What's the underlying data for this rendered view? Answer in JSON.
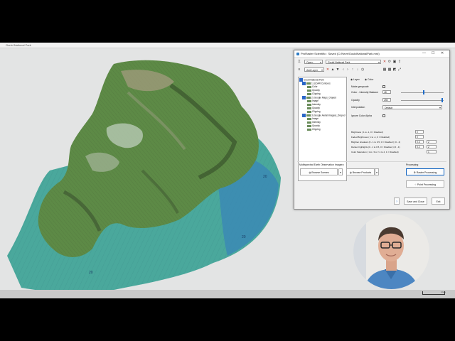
{
  "app": {
    "window_title": "Gould National Park"
  },
  "dialog": {
    "title": "ProRaster Scientific : Saved (C:/Neve/GouldNationalPark.mrd)",
    "open_label": "Open...",
    "project_name": "Gould National Park",
    "add_layer_label": "Add Layer",
    "tabs": {
      "layer": "Layer",
      "color": "Color"
    },
    "tree": [
      {
        "label": "Gould National Park",
        "level": 0,
        "checked": true
      },
      {
        "label": "1) LiDAR Contours",
        "level": 1,
        "checked": true
      },
      {
        "label": "Color",
        "level": 2
      },
      {
        "label": "Opacity",
        "level": 2
      },
      {
        "label": "Clipping",
        "level": 2
      },
      {
        "label": "2) Google Maps_Draped",
        "level": 1,
        "checked": true
      },
      {
        "label": "Image",
        "level": 2
      },
      {
        "label": "Intensity",
        "level": 2
      },
      {
        "label": "Opacity",
        "level": 2
      },
      {
        "label": "Clipping",
        "level": 2
      },
      {
        "label": "3) Google Aerial Imagery_Draped",
        "level": 1,
        "checked": true
      },
      {
        "label": "Image",
        "level": 2
      },
      {
        "label": "Intensity",
        "level": 2
      },
      {
        "label": "Opacity",
        "level": 2
      },
      {
        "label": "Clipping",
        "level": 2
      }
    ],
    "color": {
      "make_greyscale": "Make greyscale",
      "intensity_label": "Color - Intensity Balance",
      "intensity_value": "48",
      "opacity_label": "Opacity",
      "opacity_value": "255",
      "interpolation_label": "Interpolation",
      "interpolation_value": "Default",
      "ignore_alpha": "Ignore Color Alpha",
      "brightness_label": "Brightness ( 1 to -1, 0 = Disabled)",
      "brightness_value": "0",
      "faded_label": "Faded Brightness ( 1 to -1, 0 = Disabled)",
      "faded_value": "0",
      "shadows_label": "Brighten shadows (0 - 1 to 0.5, 0 = Disabled ) (0 - 4)",
      "shadows_value_1": "0.3",
      "shadows_value_2": "2",
      "highlights_label": "Darken highlights (0 - 1 to 0.5, 0 = Disabled ) (0 - 4)",
      "highlights_value_1": "0.2",
      "highlights_value_2": "2",
      "saturation_label": "Color Saturation ( 1 to <0 or >1 to 4, 1 = Disabled)",
      "saturation_value": "1"
    },
    "multispectral": {
      "header": "Multispectral Earth Observation Imagery",
      "browse_scenes": "Browse Scenes",
      "browse_products": "Browse Products"
    },
    "processing": {
      "header": "Processing",
      "raster": "Raster Processing",
      "point": "Point Processing"
    },
    "save_close": "Save and Close",
    "exit": "Exit",
    "help": "?"
  },
  "overlay": {
    "scale_label": "1 km"
  },
  "colors": {
    "accent": "#1b6ac9",
    "water": "#41a7a0",
    "terrain": "#5d8a46"
  }
}
